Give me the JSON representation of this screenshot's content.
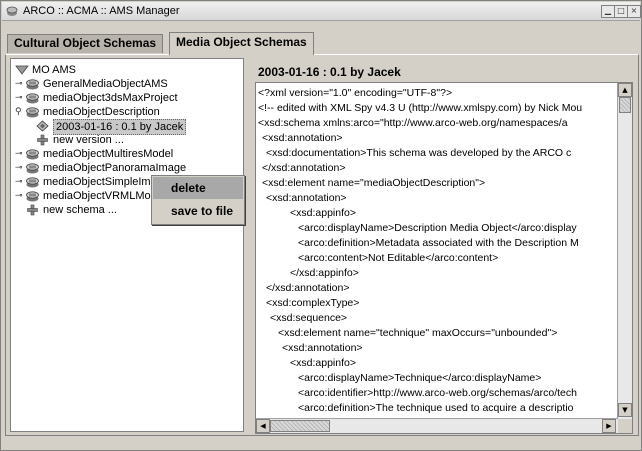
{
  "window": {
    "title": "ARCO :: ACMA :: AMS Manager",
    "controls": [
      "minimize",
      "maximize",
      "close"
    ]
  },
  "tabs": [
    {
      "label": "Cultural Object Schemas",
      "active": false
    },
    {
      "label": "Media Object Schemas",
      "active": true
    }
  ],
  "tree": {
    "root": "MO AMS",
    "items": [
      {
        "label": "GeneralMediaObjectAMS",
        "icon": "schema-icon"
      },
      {
        "label": "mediaObject3dsMaxProject",
        "icon": "schema-icon"
      },
      {
        "label": "mediaObjectDescription",
        "icon": "schema-icon",
        "expanded": true
      },
      {
        "label": "2003-01-16 : 0.1 by Jacek",
        "icon": "version-icon",
        "selected": true,
        "child": true
      },
      {
        "label": "new version ...",
        "icon": "add-icon",
        "child": true
      },
      {
        "label": "mediaObjectMultiresModel",
        "icon": "schema-icon"
      },
      {
        "label": "mediaObjectPanoramaImage",
        "icon": "schema-icon"
      },
      {
        "label": "mediaObjectSimpleImage",
        "icon": "schema-icon"
      },
      {
        "label": "mediaObjectVRMLModel",
        "icon": "schema-icon"
      },
      {
        "label": "new schema ...",
        "icon": "add-icon"
      }
    ]
  },
  "context_menu": {
    "items": [
      {
        "label": "delete",
        "hover": true
      },
      {
        "label": "save to file",
        "hover": false
      }
    ]
  },
  "schema_view": {
    "header": "2003-01-16 : 0.1 by Jacek",
    "lines": [
      "<?xml version=\"1.0\" encoding=\"UTF-8\"?>",
      "<!-- edited with XML Spy v4.3 U (http://www.xmlspy.com) by Nick Mou",
      "<xsd:schema xmlns:arco=\"http://www.arco-web.org/namespaces/a",
      "<xsd:annotation>",
      "<xsd:documentation>This schema was developed by the ARCO c",
      "</xsd:annotation>",
      "<xsd:element name=\"mediaObjectDescription\">",
      "<xsd:annotation>",
      "<xsd:appinfo>",
      "<arco:displayName>Description Media Object</arco:display",
      "<arco:definition>Metadata associated with the Description M",
      "<arco:content>Not Editable</arco:content>",
      "</xsd:appinfo>",
      "</xsd:annotation>",
      "<xsd:complexType>",
      "<xsd:sequence>",
      "<xsd:element name=\"technique\" maxOccurs=\"unbounded\">",
      "<xsd:annotation>",
      "<xsd:appinfo>",
      "<arco:displayName>Technique</arco:displayName>",
      "<arco:identifier>http://www.arco-web.org/schemas/arco/tech",
      "<arco:definition>The technique used to acquire a descriptio"
    ]
  }
}
